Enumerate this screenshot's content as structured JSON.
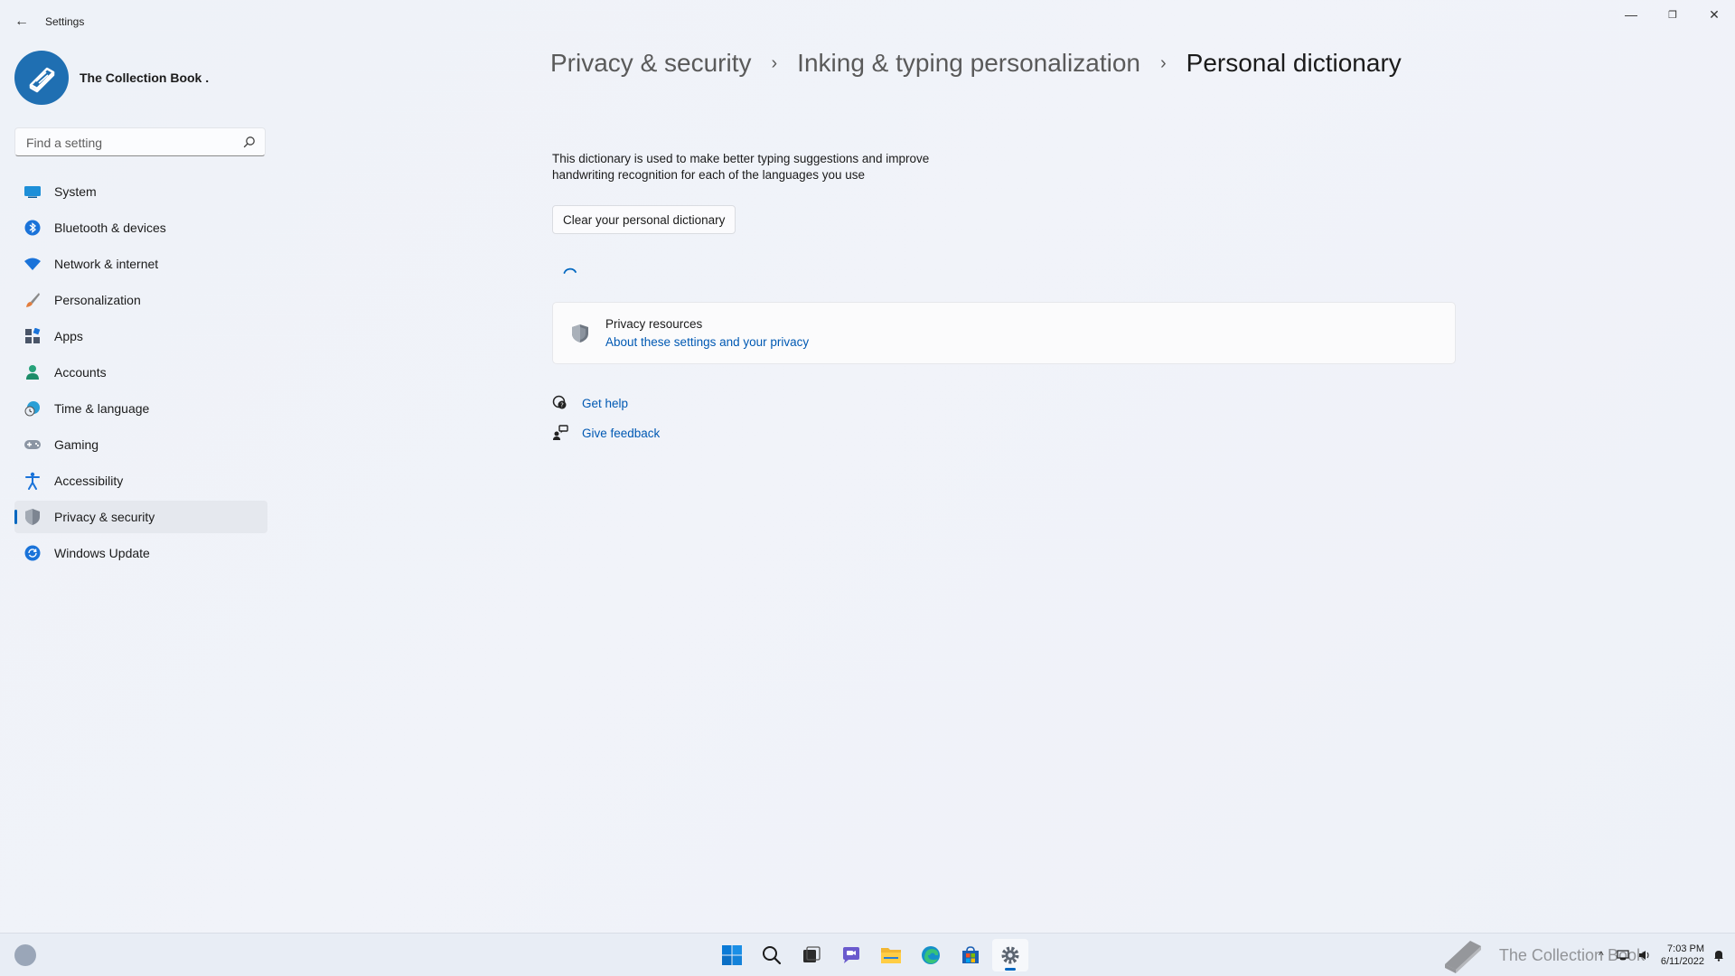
{
  "window": {
    "title": "Settings",
    "back_glyph": "←",
    "minimize_glyph": "—",
    "restore_glyph": "❐",
    "close_glyph": "✕"
  },
  "profile": {
    "name": "The Collection Book ."
  },
  "search": {
    "placeholder": "Find a setting"
  },
  "sidebar": {
    "items": [
      {
        "label": "System",
        "icon": "system-icon"
      },
      {
        "label": "Bluetooth & devices",
        "icon": "bluetooth-icon"
      },
      {
        "label": "Network & internet",
        "icon": "wifi-icon"
      },
      {
        "label": "Personalization",
        "icon": "brush-icon"
      },
      {
        "label": "Apps",
        "icon": "apps-icon"
      },
      {
        "label": "Accounts",
        "icon": "account-icon"
      },
      {
        "label": "Time & language",
        "icon": "globe-clock-icon"
      },
      {
        "label": "Gaming",
        "icon": "gamepad-icon"
      },
      {
        "label": "Accessibility",
        "icon": "accessibility-icon"
      },
      {
        "label": "Privacy & security",
        "icon": "shield-icon",
        "active": true
      },
      {
        "label": "Windows Update",
        "icon": "update-icon"
      }
    ]
  },
  "breadcrumb": {
    "level1": "Privacy & security",
    "level2": "Inking & typing personalization",
    "current": "Personal dictionary",
    "separator": "›"
  },
  "main": {
    "description": "This dictionary is used to make better typing suggestions and improve handwriting recognition for each of the languages you use",
    "clear_button": "Clear your personal dictionary",
    "privacy_card": {
      "title": "Privacy resources",
      "link": "About these settings and your privacy"
    },
    "get_help": "Get help",
    "give_feedback": "Give feedback"
  },
  "taskbar": {
    "apps": [
      "start-icon",
      "search-icon",
      "task-view-icon",
      "chat-icon",
      "file-explorer-icon",
      "edge-icon",
      "store-icon",
      "settings-icon"
    ],
    "watermark": "The Collection Book",
    "time": "7:03 PM",
    "date": "6/11/2022"
  },
  "colors": {
    "accent": "#0067c0",
    "link": "#0059b3"
  }
}
